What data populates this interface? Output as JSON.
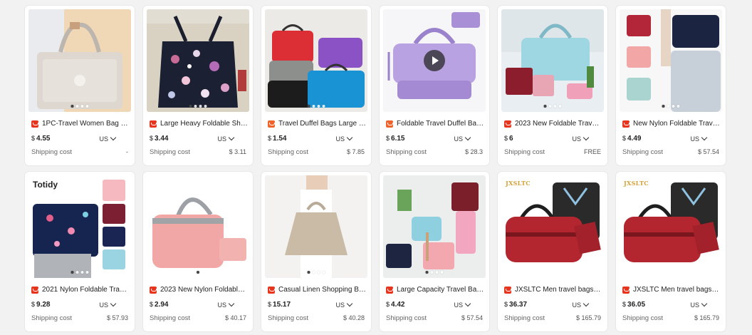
{
  "products": [
    {
      "title": "1PC-Travel Women Bag O...",
      "currency": "$",
      "price": "4.55",
      "region": "US",
      "shipping_label": "Shipping cost",
      "shipping": "-",
      "image": "beige-foldable-bag-image"
    },
    {
      "title": "Large Heavy Foldable Sho...",
      "currency": "$",
      "price": "3.44",
      "region": "US",
      "shipping_label": "Shipping cost",
      "shipping": "$ 3.11",
      "image": "floral-shopping-bag-image"
    },
    {
      "title": "Travel Duffel Bags Large F...",
      "currency": "$",
      "price": "1.54",
      "region": "US",
      "shipping_label": "Shipping cost",
      "shipping": "$ 7.85",
      "image": "colorful-duffel-bags-image"
    },
    {
      "title": "Foldable Travel Duffel Bag...",
      "currency": "$",
      "price": "6.15",
      "region": "US",
      "shipping_label": "Shipping cost",
      "shipping": "$ 28.3",
      "image": "purple-duffel-bag-image"
    },
    {
      "title": "2023 New Foldable Travel ...",
      "currency": "$",
      "price": "6",
      "region": "US",
      "shipping_label": "Shipping cost",
      "shipping": "FREE",
      "image": "blue-travel-bag-image"
    },
    {
      "title": "New Nylon Foldable Travel...",
      "currency": "$",
      "price": "4.49",
      "region": "US",
      "shipping_label": "Shipping cost",
      "shipping": "$ 57.54",
      "image": "nylon-bags-luggage-image"
    },
    {
      "title": "2021 Nylon Foldable Trave...",
      "currency": "$",
      "price": "9.28",
      "region": "US",
      "shipping_label": "Shipping cost",
      "shipping": "$ 57.93",
      "image": "navy-flamingo-bag-image",
      "logo": "Totidy"
    },
    {
      "title": "2023 New Nylon Foldable ...",
      "currency": "$",
      "price": "2.94",
      "region": "US",
      "shipping_label": "Shipping cost",
      "shipping": "$ 40.17",
      "image": "pink-foldable-bag-image"
    },
    {
      "title": "Casual Linen Shopping Ba...",
      "currency": "$",
      "price": "15.17",
      "region": "US",
      "shipping_label": "Shipping cost",
      "shipping": "$ 40.28",
      "image": "linen-shopping-bag-image"
    },
    {
      "title": "Large Capacity Travel Bag ...",
      "currency": "$",
      "price": "4.42",
      "region": "US",
      "shipping_label": "Shipping cost",
      "shipping": "$ 57.54",
      "image": "travel-bags-room-image"
    },
    {
      "title": "JXSLTC Men travel bags fo...",
      "currency": "$",
      "price": "36.37",
      "region": "US",
      "shipping_label": "Shipping cost",
      "shipping": "$ 165.79",
      "image": "red-garment-duffel-image",
      "logo": "JXSLTC"
    },
    {
      "title": "JXSLTC Men travel bags fo...",
      "currency": "$",
      "price": "36.05",
      "region": "US",
      "shipping_label": "Shipping cost",
      "shipping": "$ 165.79",
      "image": "red-garment-duffel-image",
      "logo": "JXSLTC"
    }
  ],
  "colors": {
    "store_icon": "#e8341c",
    "background": "#f2f2f2"
  }
}
